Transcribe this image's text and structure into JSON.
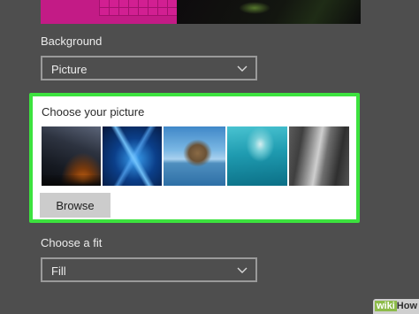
{
  "background_section": {
    "label": "Background",
    "dropdown_value": "Picture"
  },
  "picture_section": {
    "label": "Choose your picture",
    "thumbnails": [
      {
        "name": "night-sky-campfire"
      },
      {
        "name": "windows-logo-light"
      },
      {
        "name": "beach-rock-arch"
      },
      {
        "name": "underwater-swimmer"
      },
      {
        "name": "rock-cliff"
      }
    ],
    "browse_label": "Browse",
    "highlight_color": "#3ce23e"
  },
  "fit_section": {
    "label": "Choose a fit",
    "dropdown_value": "Fill"
  },
  "watermark": {
    "part1": "wiki",
    "part2": "How"
  }
}
